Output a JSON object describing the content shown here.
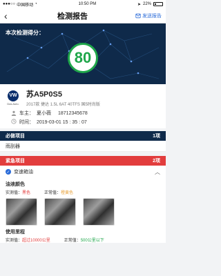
{
  "status_bar": {
    "carrier": "中国移动",
    "network": "WiFi",
    "time": "10:50 PM",
    "battery": "22%"
  },
  "header": {
    "back_icon": "back-chevron-icon",
    "title": "检测报告",
    "send_label": "发送报告",
    "send_icon": "send-report-icon"
  },
  "score": {
    "label": "本次检测得分：",
    "value": "80",
    "circle_color": "#1fa64a",
    "panel_color": "#0f2a4a"
  },
  "car": {
    "plate": "苏A5P0S5",
    "model": "2017款 捷达 1.5L 6AT 40TFS 国5时尚版",
    "brand": "Das Auto.",
    "owner_label": "车主：",
    "owner_name": "夏小薇",
    "owner_phone": "18712345678",
    "time_label": "时间：",
    "time_value": "2019-03-01  15 : 35 : 07"
  },
  "must": {
    "title": "必做项目",
    "count": "1项",
    "items": [
      "雨刮器"
    ]
  },
  "urgent": {
    "title": "紧急项目",
    "count": "2项",
    "sub_title": "变速箱油",
    "oil_color": {
      "title": "油液颜色",
      "actual_label": "实测值：",
      "actual_value": "黑色",
      "normal_label": "正常值：",
      "normal_value": "橙黄色"
    },
    "mileage": {
      "title": "使用里程",
      "actual_label": "实测值：",
      "actual_value": "超过10000公里",
      "normal_label": "正常值：",
      "normal_value": "500公里以下"
    }
  }
}
